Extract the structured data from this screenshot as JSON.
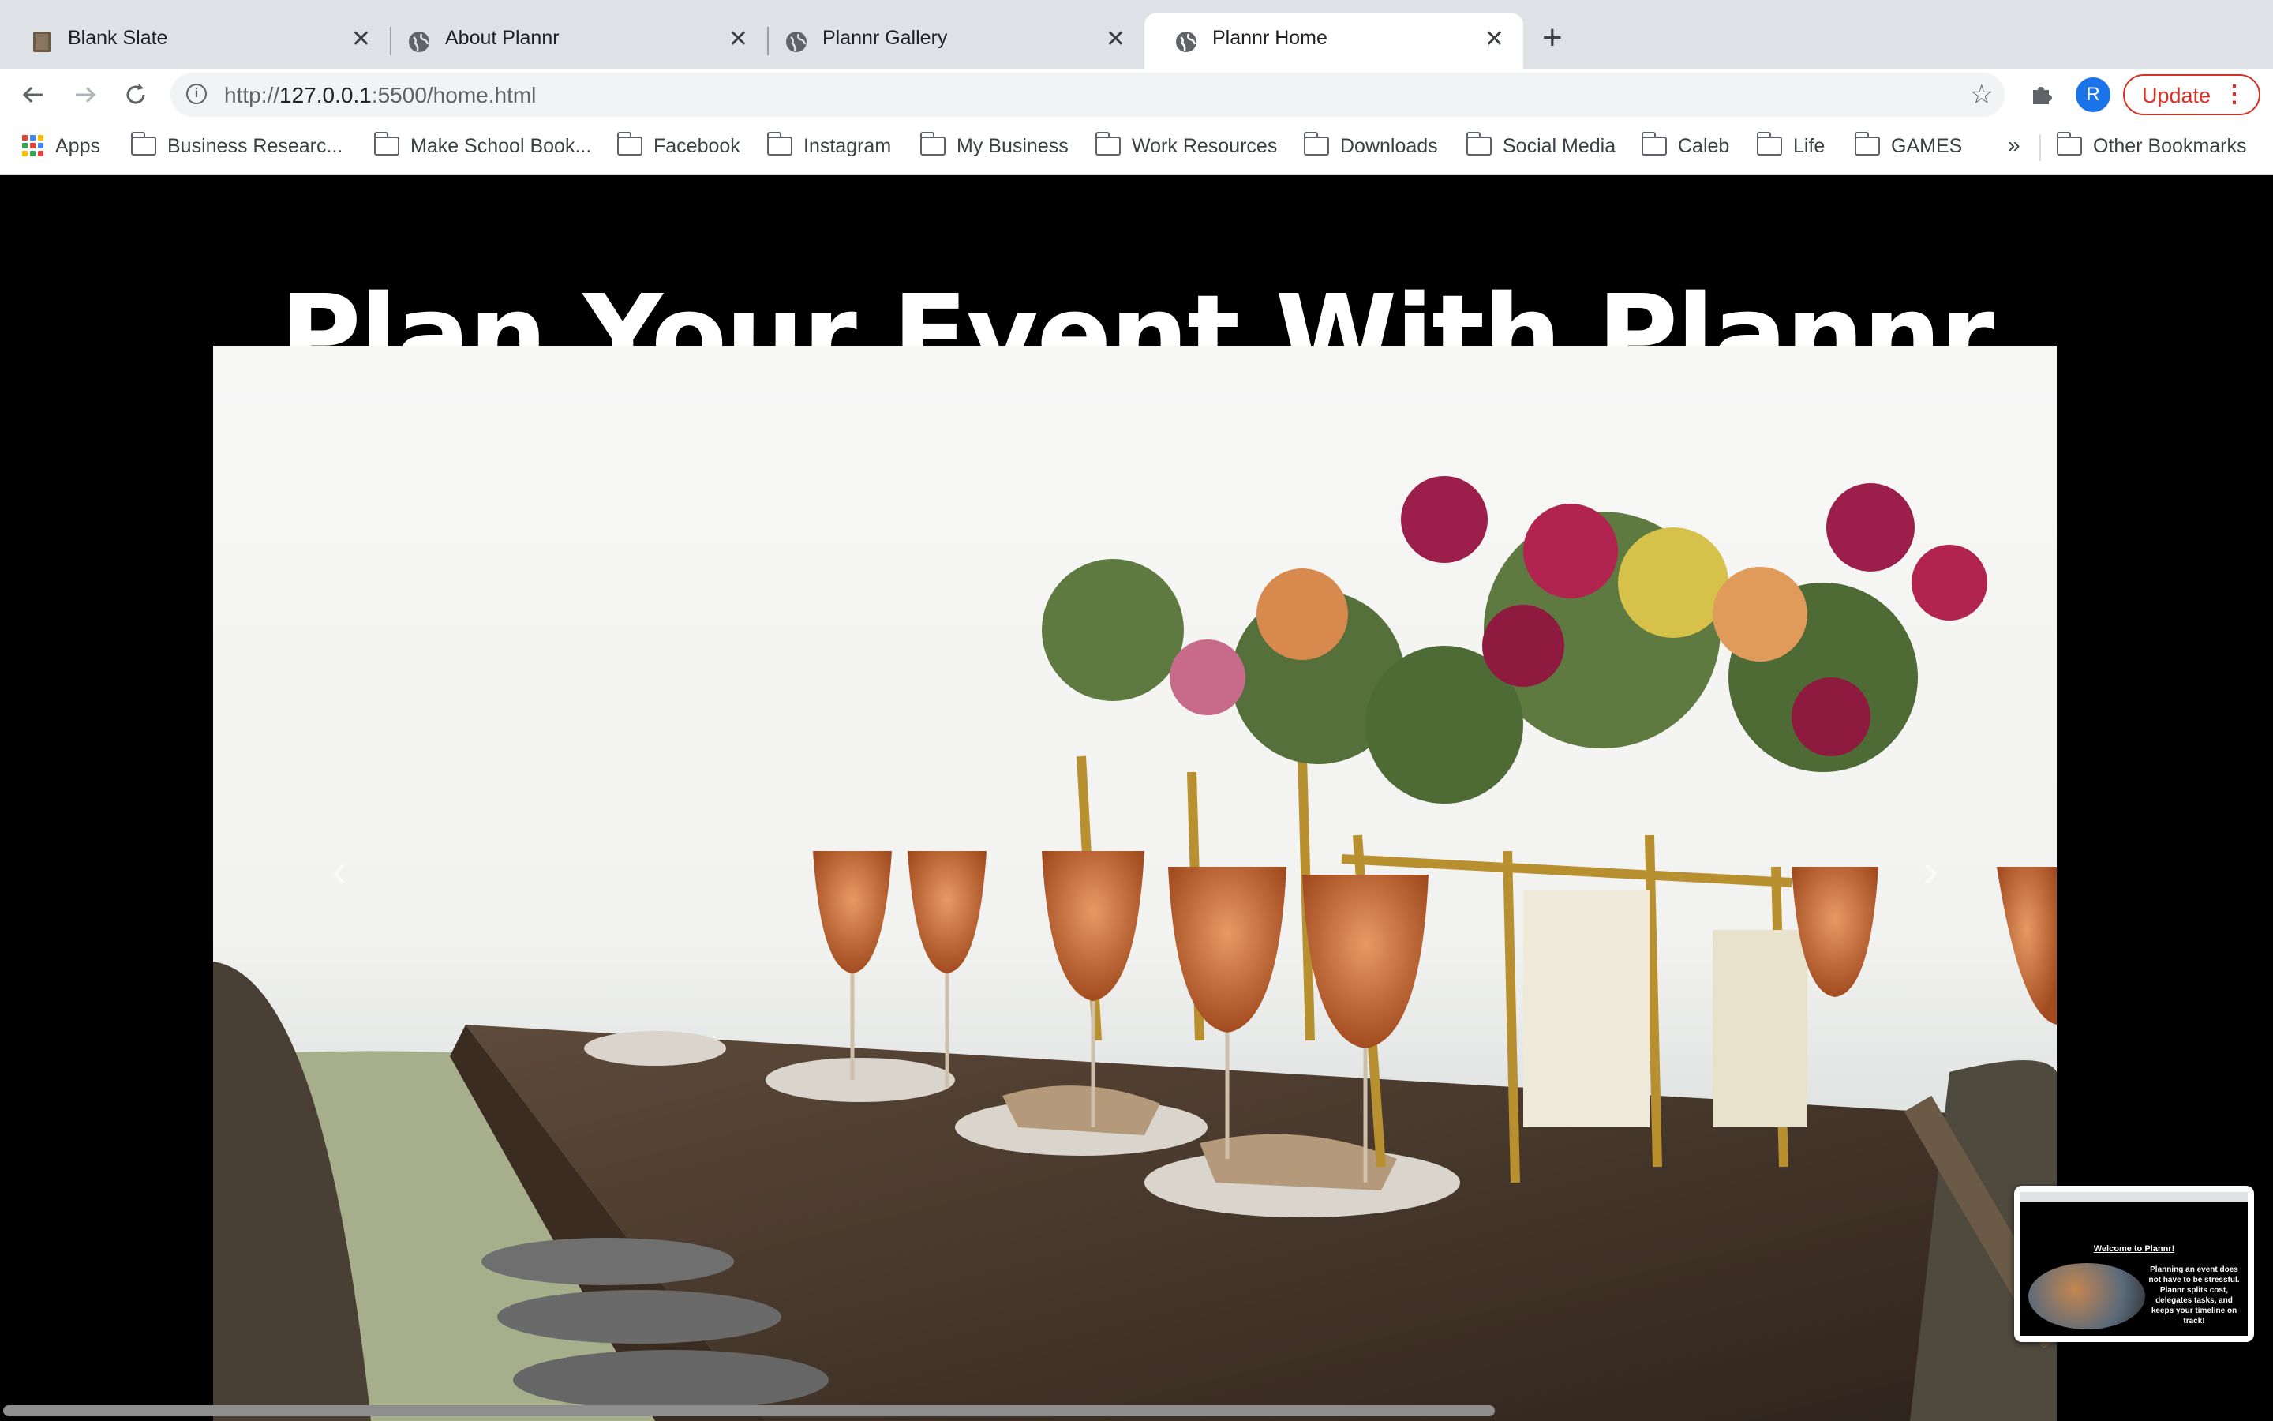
{
  "browser": {
    "tabs": [
      {
        "title": "Blank Slate",
        "favicon": "notebook-icon",
        "active": false
      },
      {
        "title": "About Plannr",
        "favicon": "globe-icon",
        "active": false
      },
      {
        "title": "Plannr Gallery",
        "favicon": "globe-icon",
        "active": false
      },
      {
        "title": "Plannr Home",
        "favicon": "globe-icon",
        "active": true
      }
    ],
    "url_prefix": "http://",
    "url_host": "127.0.0.1",
    "url_rest": ":5500/home.html",
    "profile_initial": "R",
    "update_label": "Update",
    "bookmarks": [
      {
        "label": "Apps",
        "icon": "apps-grid-icon"
      },
      {
        "label": "Business Researc...",
        "icon": "folder-icon"
      },
      {
        "label": "Make School Book...",
        "icon": "folder-icon"
      },
      {
        "label": "Facebook",
        "icon": "folder-icon"
      },
      {
        "label": "Instagram",
        "icon": "folder-icon"
      },
      {
        "label": "My Business",
        "icon": "folder-icon"
      },
      {
        "label": "Work Resources",
        "icon": "folder-icon"
      },
      {
        "label": "Downloads",
        "icon": "folder-icon"
      },
      {
        "label": "Social Media",
        "icon": "folder-icon"
      },
      {
        "label": "Caleb",
        "icon": "folder-icon"
      },
      {
        "label": "Life",
        "icon": "folder-icon"
      },
      {
        "label": "GAMES",
        "icon": "folder-icon"
      }
    ],
    "overflow_label": "»",
    "other_bookmarks": "Other Bookmarks"
  },
  "page": {
    "heading": "Plan Your Event With Plannr",
    "hero_image": "banquet-table-with-floral-centerpieces",
    "thumbnail": {
      "title": "Welcome to Plannr!",
      "body": "Planning an event does not have to be stressful. Plannr splits cost, delegates tasks, and keeps your timeline on track!"
    }
  },
  "colors": {
    "accent_update": "#d93025",
    "avatar": "#1a73e8",
    "page_background": "#000000"
  }
}
